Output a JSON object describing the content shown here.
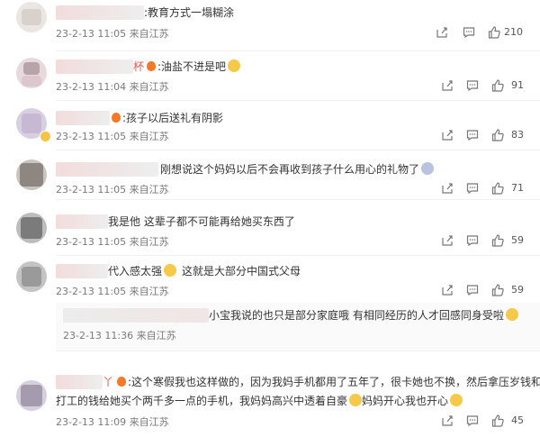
{
  "comments": [
    {
      "text": ":教育方式一塌糊涂",
      "meta": "23-2-13 11:05 来自江苏",
      "likes": "210"
    },
    {
      "name_suffix": "杯",
      "text": ":油盐不进是吧",
      "meta": "23-2-13 11:04 来自江苏",
      "likes": "91"
    },
    {
      "text": ":孩子以后送礼有阴影",
      "meta": "23-2-13 11:05 来自江苏",
      "likes": "83"
    },
    {
      "text": "刚想说这个妈妈以后不会再收到孩子什么用心的礼物了",
      "meta": "23-2-13 11:05 来自江苏",
      "likes": "71"
    },
    {
      "text": "我是他  这辈子都不可能再给她买东西了",
      "meta": "23-2-13 11:05 来自江苏",
      "likes": "59"
    },
    {
      "text": "代入感太强",
      "text2": "这就是大部分中国式父母",
      "meta": "23-2-13 11:05 来自江苏",
      "likes": "59"
    },
    {
      "text": "小宝我说的也只是部分家庭哦  有相同经历的人才回感同身受啦",
      "meta": "23-2-13 11:36 来自江苏",
      "likes": ""
    },
    {
      "name_suffix": "丫",
      "line1": ":这个寒假我也这样做的，因为我妈手机都用了五年了，很卡她也不换，然后拿压岁钱和暑假",
      "line2": "打工的钱给她买个两千多一点的手机，我妈妈高兴中透着自豪",
      "line2b": "妈妈开心我也开心",
      "meta": "23-2-13 11:09 来自江苏",
      "likes": "45"
    }
  ],
  "icons": {
    "share": "share-icon",
    "comment": "comment-icon",
    "like": "like-icon"
  },
  "colors": {
    "meta": "#7a7a7a",
    "divider": "#f0f0f0",
    "vip_badge": "#f5c443"
  }
}
